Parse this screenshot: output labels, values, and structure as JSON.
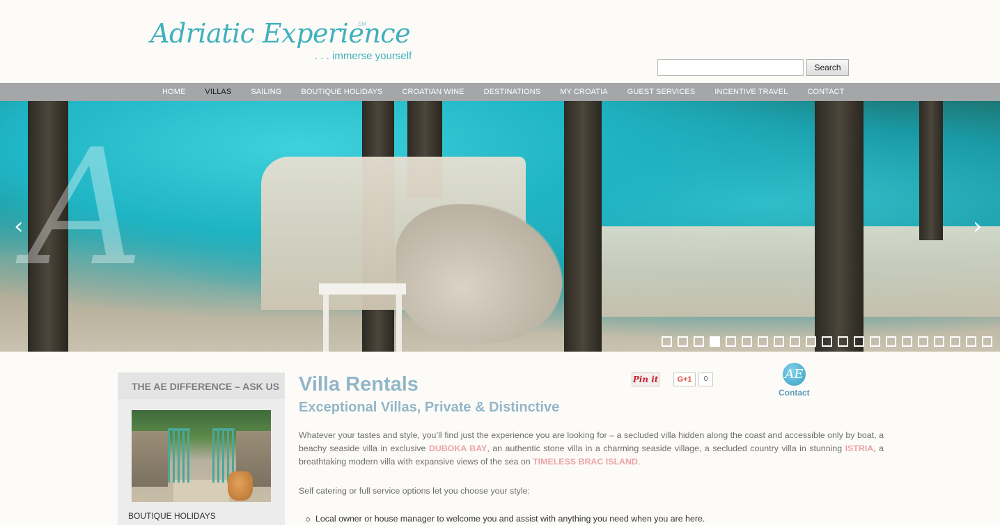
{
  "header": {
    "logo_main": "Adriatic Experience",
    "logo_sm": "SM",
    "logo_tagline": ". . . immerse yourself",
    "search_placeholder": "",
    "search_button": "Search"
  },
  "nav": {
    "items": [
      {
        "label": "HOME",
        "active": false
      },
      {
        "label": "VILLAS",
        "active": true
      },
      {
        "label": "SAILING",
        "active": false
      },
      {
        "label": "BOUTIQUE HOLIDAYS",
        "active": false
      },
      {
        "label": "CROATIAN WINE",
        "active": false
      },
      {
        "label": "DESTINATIONS",
        "active": false
      },
      {
        "label": "MY CROATIA",
        "active": false
      },
      {
        "label": "GUEST SERVICES",
        "active": false
      },
      {
        "label": "INCENTIVE TRAVEL",
        "active": false
      },
      {
        "label": "CONTACT",
        "active": false
      }
    ]
  },
  "hero": {
    "slide_count": 21,
    "active_slide": 4,
    "prev_icon": "chevron-left-icon",
    "next_icon": "chevron-right-icon",
    "prev_glyph": "‹",
    "next_glyph": "›"
  },
  "sidebar": {
    "title": "THE AE DIFFERENCE – ASK US",
    "caption": "BOUTIQUE HOLIDAYS"
  },
  "social": {
    "pinit": "Pin it",
    "gplus": "G+1",
    "gplus_count": "0",
    "contact_icon_glyph": "AE",
    "contact_label": "Contact"
  },
  "main": {
    "title": "Villa Rentals",
    "subtitle": "Exceptional Villas, Private & Distinctive",
    "p1_a": "Whatever your tastes and style, you’ll find just the experience you are looking for – a secluded villa hidden along the coast and accessible only by boat, a beachy seaside villa in exclusive ",
    "p1_link1": "Duboka Bay",
    "p1_b": ", an authentic stone villa in a charming seaside village, a secluded country villa  in stunning ",
    "p1_link2": "Istria",
    "p1_c": ", a breathtaking modern villa with expansive views of the sea on ",
    "p1_link3": "Timeless Brac Island",
    "p1_d": ".",
    "p2": "Self catering or full service options let you choose your style:",
    "bullet1": "Local owner or house manager to welcome you and assist with anything you need when you are here."
  },
  "colors": {
    "accent_teal": "#3fb0bd",
    "nav_bg": "#a4a6a8",
    "heading_blue": "#92b6c8",
    "link_pink": "#eaa4a4"
  }
}
